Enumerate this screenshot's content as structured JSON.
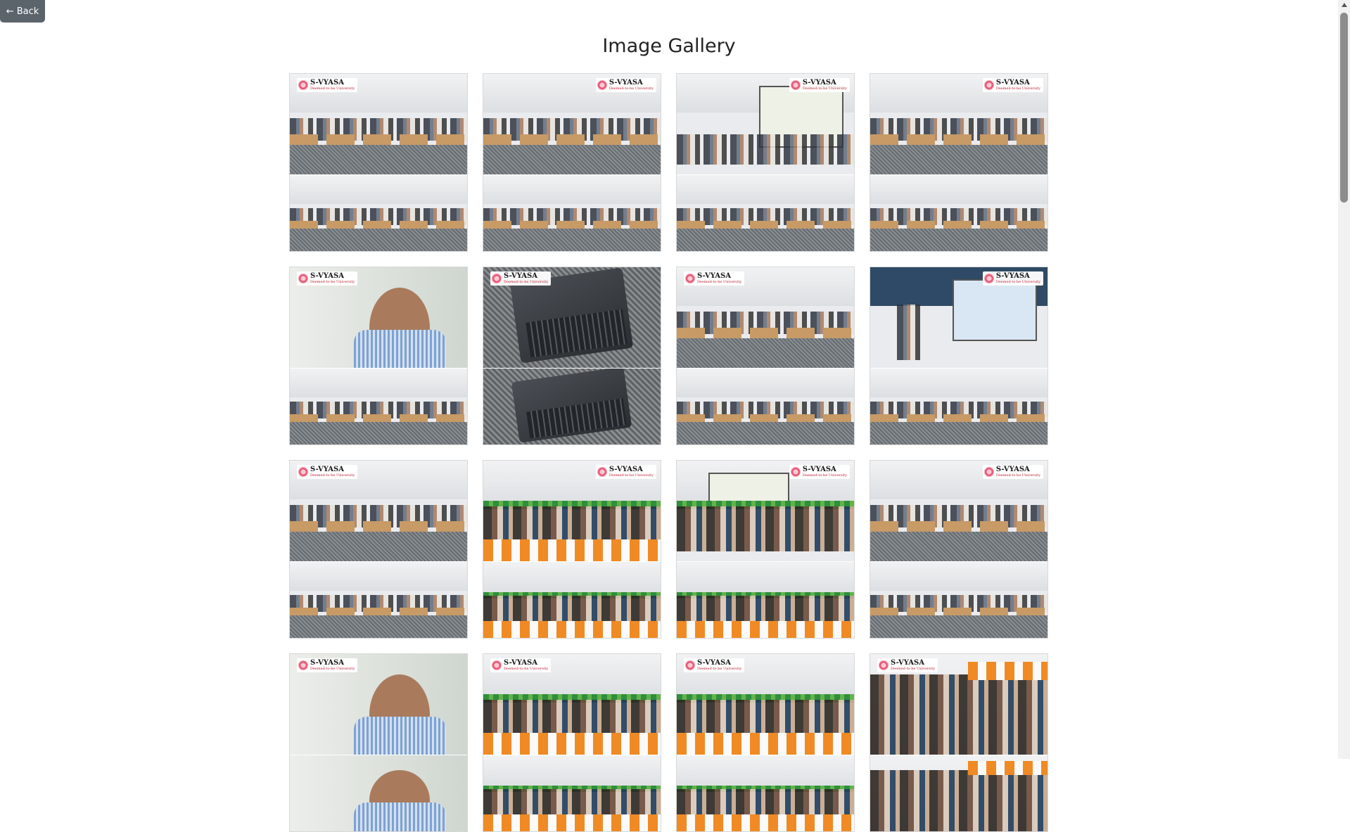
{
  "back_button": {
    "label": "← Back"
  },
  "gallery": {
    "title": "Image Gallery",
    "logo_text": "S-VYASA",
    "logo_subtext": "Deemed-to-be University",
    "images": [
      {
        "scene_top": "classroom",
        "scene_bottom": "classroom"
      },
      {
        "scene_top": "classroom",
        "scene_bottom": "classroom"
      },
      {
        "scene_top": "presenter-screen",
        "scene_bottom": "classroom"
      },
      {
        "scene_top": "classroom",
        "scene_bottom": "classroom"
      },
      {
        "scene_top": "portrait",
        "scene_bottom": "classroom"
      },
      {
        "scene_top": "laptop",
        "scene_bottom": "laptop"
      },
      {
        "scene_top": "classroom",
        "scene_bottom": "classroom"
      },
      {
        "scene_top": "presenter-screen-blue",
        "scene_bottom": "classroom"
      },
      {
        "scene_top": "classroom",
        "scene_bottom": "classroom"
      },
      {
        "scene_top": "auditorium",
        "scene_bottom": "auditorium"
      },
      {
        "scene_top": "auditorium-screen",
        "scene_bottom": "auditorium"
      },
      {
        "scene_top": "classroom",
        "scene_bottom": "classroom"
      },
      {
        "scene_top": "portrait",
        "scene_bottom": "portrait"
      },
      {
        "scene_top": "auditorium",
        "scene_bottom": "auditorium"
      },
      {
        "scene_top": "auditorium",
        "scene_bottom": "auditorium"
      },
      {
        "scene_top": "group-chat",
        "scene_bottom": "group-chat"
      }
    ]
  }
}
